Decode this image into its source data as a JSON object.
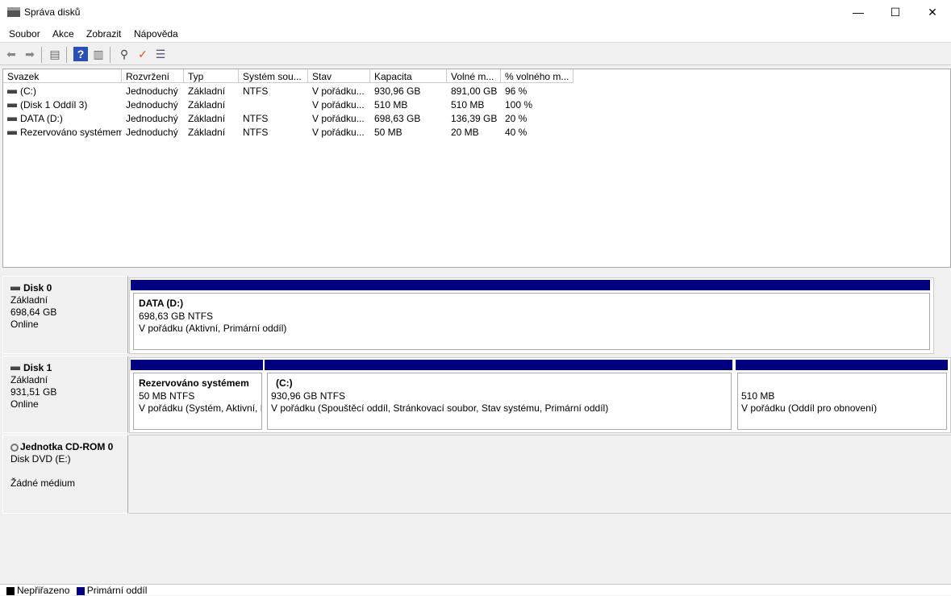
{
  "window": {
    "title": "Správa disků",
    "minimize": "—",
    "maximize": "☐",
    "close": "✕"
  },
  "menu": [
    "Soubor",
    "Akce",
    "Zobrazit",
    "Nápověda"
  ],
  "toolbar": {
    "icons": [
      "back-icon",
      "forward-icon",
      "console-tree-icon",
      "help-icon",
      "action-pane-icon",
      "rescan-disks-icon",
      "check-icon",
      "properties-icon"
    ]
  },
  "columns": [
    "Svazek",
    "Rozvržení",
    "Typ",
    "Systém sou...",
    "Stav",
    "Kapacita",
    "Volné m...",
    "% volného m..."
  ],
  "volumes": [
    [
      "(C:)",
      "Jednoduchý",
      "Základní",
      "NTFS",
      "V pořádku...",
      "930,96 GB",
      "891,00 GB",
      "96 %"
    ],
    [
      "(Disk 1 Oddíl 3)",
      "Jednoduchý",
      "Základní",
      "",
      "V pořádku...",
      "510 MB",
      "510 MB",
      "100 %"
    ],
    [
      "DATA (D:)",
      "Jednoduchý",
      "Základní",
      "NTFS",
      "V pořádku...",
      "698,63 GB",
      "136,39 GB",
      "20 %"
    ],
    [
      "Rezervováno systémem",
      "Jednoduchý",
      "Základní",
      "NTFS",
      "V pořádku...",
      "50 MB",
      "20 MB",
      "40 %"
    ]
  ],
  "disks": [
    {
      "name": "Disk 0",
      "type": "Základní",
      "size": "698,64 GB",
      "status": "Online",
      "partitions": [
        {
          "name": "DATA  (D:)",
          "size": "698,63 GB NTFS",
          "status": "V pořádku (Aktivní, Primární oddíl)"
        }
      ]
    },
    {
      "name": "Disk 1",
      "type": "Základní",
      "size": "931,51 GB",
      "status": "Online",
      "partitions": [
        {
          "name": "Rezervováno systémem",
          "size": "50 MB NTFS",
          "status": "V pořádku (Systém, Aktivní, Primární oddíl)"
        },
        {
          "name": "(C:)",
          "size": "930,96 GB NTFS",
          "status": "V pořádku (Spouštěcí oddíl, Stránkovací soubor, Stav systému, Primární oddíl)"
        },
        {
          "name": "",
          "size": "510 MB",
          "status": "V pořádku (Oddíl pro obnovení)"
        }
      ]
    }
  ],
  "cdrom": {
    "name": "Jednotka CD-ROM 0",
    "type": "Disk DVD (E:)",
    "status": "Žádné médium"
  },
  "legend": [
    {
      "label": "Nepřiřazeno",
      "color": "#000000"
    },
    {
      "label": "Primární oddíl",
      "color": "#000080"
    }
  ]
}
